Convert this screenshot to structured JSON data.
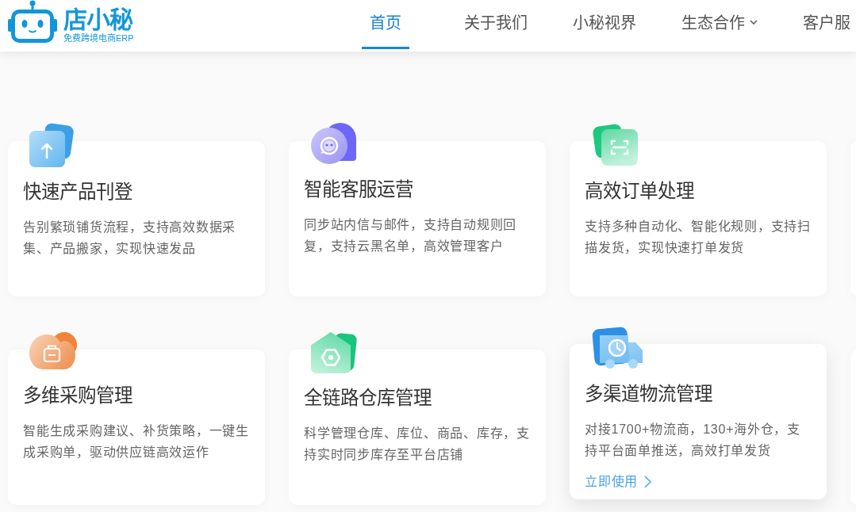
{
  "header": {
    "logo": {
      "name": "店小秘",
      "tagline": "免费跨境电商ERP"
    },
    "nav": [
      {
        "label": "首页",
        "selected": true,
        "dropdown": false
      },
      {
        "label": "关于我们",
        "selected": false,
        "dropdown": false
      },
      {
        "label": "小秘视界",
        "selected": false,
        "dropdown": false
      },
      {
        "label": "生态合作",
        "selected": false,
        "dropdown": true
      },
      {
        "label": "客户服",
        "selected": false,
        "dropdown": false
      }
    ]
  },
  "features": [
    {
      "title": "快速产品刊登",
      "description": "告别繁琐铺货流程，支持高效数据采集、产品搬家，实现快速发品"
    },
    {
      "title": "智能客服运营",
      "description": "同步站内信与邮件，支持自动规则回复，支持云黑名单，高效管理客户"
    },
    {
      "title": "高效订单处理",
      "description": "支持多种自动化、智能化规则，支持扫描发货，实现快速打单发货"
    },
    {
      "title": "多维采购管理",
      "description": "智能生成采购建议、补货策略，一键生成采购单，驱动供应链高效运作"
    },
    {
      "title": "全链路仓库管理",
      "description": "科学管理仓库、库位、商品、库存，支持实时同步库存至平台店铺"
    },
    {
      "title": "多渠道物流管理",
      "description": "对接1700+物流商，130+海外仓，支持平台面单推送，高效打单发货",
      "hovered": true,
      "link": "立即使用"
    }
  ]
}
